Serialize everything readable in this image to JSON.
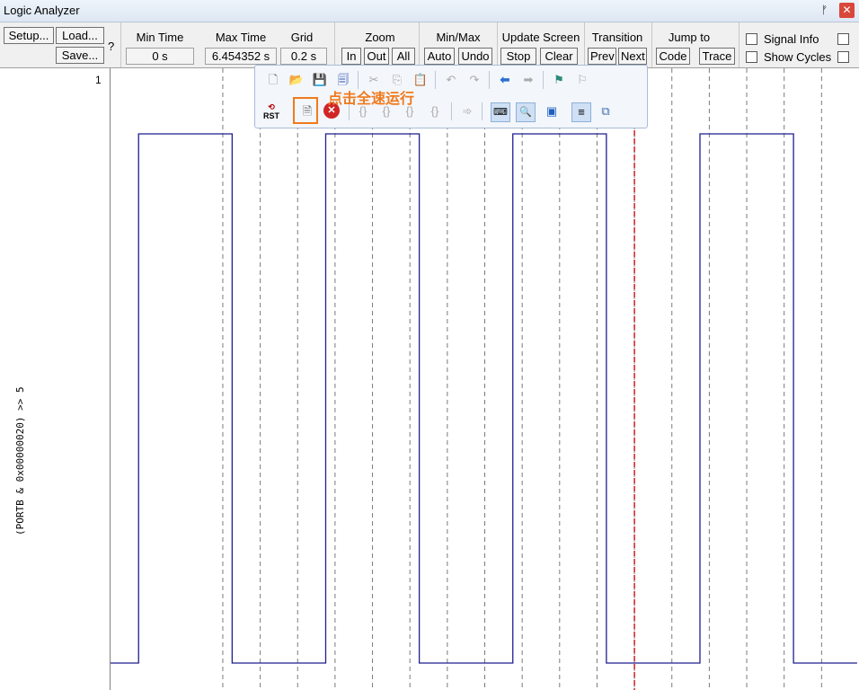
{
  "window": {
    "title": "Logic Analyzer",
    "pin_glyph": "ᚠ",
    "close_glyph": "✕"
  },
  "toolbar": {
    "setup": "Setup...",
    "load": "Load...",
    "save": "Save...",
    "help": "?",
    "min_time_label": "Min Time",
    "min_time_value": "0 s",
    "max_time_label": "Max Time",
    "max_time_value": "6.454352 s",
    "grid_label": "Grid",
    "grid_value": "0.2 s",
    "zoom_label": "Zoom",
    "zoom_in": "In",
    "zoom_out": "Out",
    "zoom_all": "All",
    "minmax_label": "Min/Max",
    "minmax_auto": "Auto",
    "minmax_undo": "Undo",
    "update_label": "Update Screen",
    "update_stop": "Stop",
    "update_clear": "Clear",
    "transition_label": "Transition",
    "transition_prev": "Prev",
    "transition_next": "Next",
    "jump_label": "Jump to",
    "jump_code": "Code",
    "jump_trace": "Trace",
    "signal_info": "Signal Info",
    "show_cycles": "Show Cycles"
  },
  "signal": {
    "row_number": "1",
    "expression": "(PORTB & 0x00000020) >> 5"
  },
  "annotation": {
    "text": "点击全速运行"
  },
  "chart_data": {
    "type": "line",
    "series": [
      {
        "values": [
          [
            0,
            0
          ],
          [
            0.15,
            0
          ],
          [
            0.15,
            1
          ],
          [
            0.65,
            1
          ],
          [
            0.65,
            0
          ],
          [
            1.15,
            0
          ],
          [
            1.15,
            1
          ],
          [
            1.65,
            1
          ],
          [
            1.65,
            0
          ],
          [
            2.15,
            0
          ],
          [
            2.15,
            1
          ],
          [
            2.65,
            1
          ],
          [
            2.65,
            0
          ],
          [
            3.15,
            0
          ],
          [
            3.15,
            1
          ],
          [
            3.65,
            1
          ],
          [
            3.65,
            0
          ],
          [
            3.99,
            0
          ]
        ]
      }
    ],
    "xlim": [
      0,
      4.0
    ],
    "ylim": [
      0,
      1
    ],
    "grid": true,
    "colors": {
      "signal": "#1f1f8f",
      "grid": "#7a7a7a",
      "cursor": "#d02020"
    },
    "cursor_x": 2.8
  }
}
